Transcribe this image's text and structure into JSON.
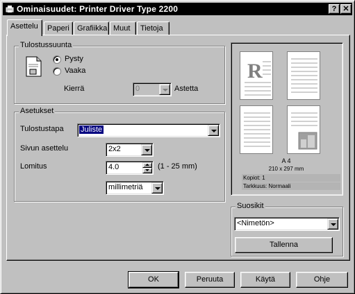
{
  "window": {
    "title": "Ominaisuudet: Printer Driver Type 2200",
    "help_btn": "?",
    "close_btn": "✕"
  },
  "tabs": [
    {
      "label": "Asettelu",
      "active": true
    },
    {
      "label": "Paperi"
    },
    {
      "label": "Grafiikka"
    },
    {
      "label": "Muut"
    },
    {
      "label": "Tietoja"
    }
  ],
  "orientation": {
    "group_label": "Tulostussuunta",
    "portrait_label": "Pysty",
    "portrait_checked": true,
    "landscape_label": "Vaaka",
    "rotate_label": "Kierrä",
    "rotate_value": "0",
    "degrees_label": "Astetta"
  },
  "settings": {
    "group_label": "Asetukset",
    "print_method_label": "Tulostustapa",
    "print_method_value": "Juliste",
    "page_layout_label": "Sivun asettelu",
    "page_layout_value": "2x2",
    "overlap_label": "Lomitus",
    "overlap_value": "4.0",
    "overlap_range": "(1 - 25 mm)",
    "unit_value": "millimetriä"
  },
  "preview": {
    "paper_name": "A 4",
    "paper_size": "210 x 297 mm",
    "copies": "Kopiot: 1",
    "resolution": "Tarkkuus: Normaali"
  },
  "favorites": {
    "group_label": "Suosikit",
    "selected": "<Nimetön>",
    "save_label": "Tallenna"
  },
  "footer": {
    "ok_label": "OK",
    "cancel_label": "Peruuta",
    "apply_label": "Käytä",
    "help_label": "Ohje"
  },
  "colors": {
    "face": "#c0c0c0",
    "titlebar": "#000000",
    "selection": "#000080"
  },
  "icons": [
    "printer-icon",
    "portrait-page-icon",
    "chevron-down-icon"
  ]
}
